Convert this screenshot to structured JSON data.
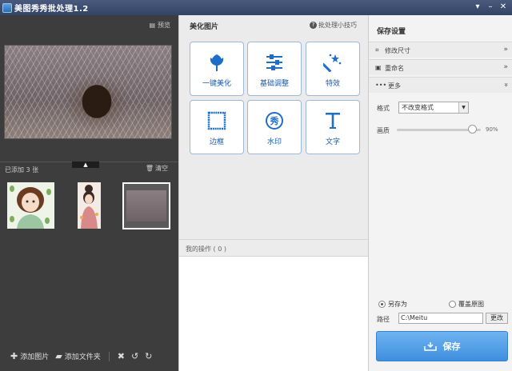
{
  "window": {
    "title": "美图秀秀批处理1.2",
    "controls": [
      "shirt-icon",
      "minimize-icon",
      "close-icon"
    ]
  },
  "left": {
    "preview_hint": "预览",
    "added_count": "已添加 3 张",
    "clear_label": "清空",
    "toolbar": {
      "add_image": "添加图片",
      "add_folder": "添加文件夹"
    }
  },
  "middle": {
    "title": "美化图片",
    "tip": "批处理小技巧",
    "tools": [
      {
        "label": "一键美化",
        "icon": "tulip-icon"
      },
      {
        "label": "基础调整",
        "icon": "sliders-icon"
      },
      {
        "label": "特效",
        "icon": "magic-wand-icon"
      },
      {
        "label": "边框",
        "icon": "frame-icon"
      },
      {
        "label": "水印",
        "icon": "watermark-icon"
      },
      {
        "label": "文字",
        "icon": "text-icon"
      }
    ],
    "history_label": "我的操作 ( 0 )"
  },
  "right": {
    "title": "保存设置",
    "sections": [
      {
        "label": "修改尺寸",
        "arrow": "»"
      },
      {
        "label": "重命名",
        "arrow": "»"
      },
      {
        "label": "更多",
        "arrow": "»"
      }
    ],
    "format_label": "格式",
    "format_value": "不改变格式",
    "quality_label": "画质",
    "quality_value": "90%",
    "quality_level": 0.9,
    "radio_save_as": "另存为",
    "radio_overwrite": "覆盖原图",
    "path_label": "路径",
    "path_value": "C:\\Meitu",
    "change_button": "更改",
    "save_button": "保存"
  },
  "colors": {
    "accent": "#3e8ee0",
    "tool_label": "#1a5aa8"
  }
}
